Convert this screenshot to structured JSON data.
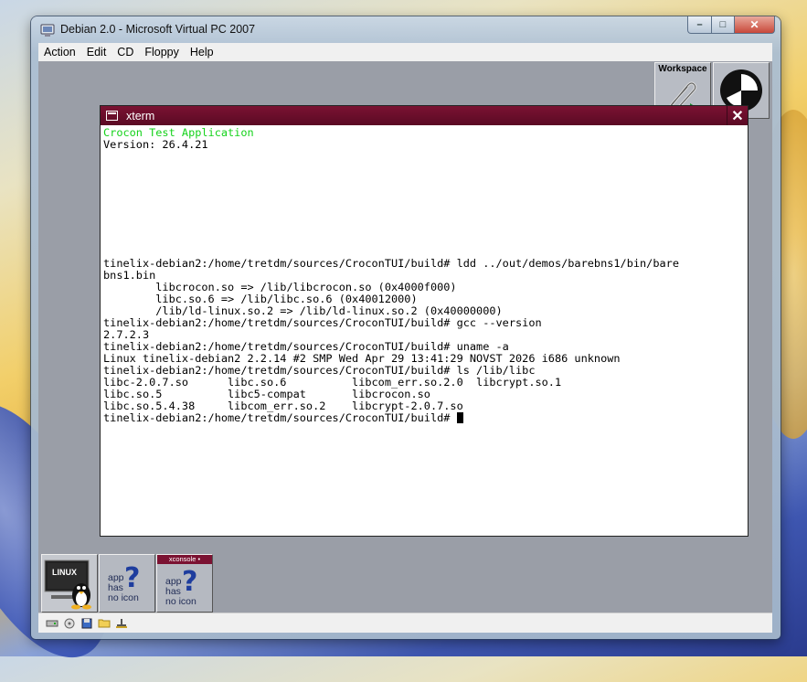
{
  "window": {
    "title": "Debian 2.0 - Microsoft Virtual PC 2007",
    "caption_buttons": {
      "minimize": "–",
      "maximize": "□",
      "close": "✕"
    }
  },
  "menubar": [
    "Action",
    "Edit",
    "CD",
    "Floppy",
    "Help"
  ],
  "dock": {
    "workspace_label": "Workspace"
  },
  "xterm": {
    "title": "xterm",
    "close_glyph": "✕",
    "header_lines": [
      "Crocon Test Application"
    ],
    "lines": [
      "Version: 26.4.21",
      "",
      "",
      "",
      "",
      "",
      "",
      "",
      "",
      "",
      "tinelix-debian2:/home/tretdm/sources/CroconTUI/build# ldd ../out/demos/barebns1/bin/bare",
      "bns1.bin",
      "        libcrocon.so => /lib/libcrocon.so (0x4000f000)",
      "        libc.so.6 => /lib/libc.so.6 (0x40012000)",
      "        /lib/ld-linux.so.2 => /lib/ld-linux.so.2 (0x40000000)",
      "tinelix-debian2:/home/tretdm/sources/CroconTUI/build# gcc --version",
      "2.7.2.3",
      "tinelix-debian2:/home/tretdm/sources/CroconTUI/build# uname -a",
      "Linux tinelix-debian2 2.2.14 #2 SMP Wed Apr 29 13:41:29 NOVST 2026 i686 unknown",
      "tinelix-debian2:/home/tretdm/sources/CroconTUI/build# ls /lib/libc",
      "libc-2.0.7.so      libc.so.6          libcom_err.so.2.0  libcrypt.so.1",
      "libc.so.5          libc5-compat       libcrocon.so",
      "libc.so.5.4.38     libcom_err.so.2    libcrypt-2.0.7.so"
    ],
    "prompt": "tinelix-debian2:/home/tretdm/sources/CroconTUI/build# "
  },
  "taskbar": {
    "linux_label": "LINUX",
    "app1_text": [
      "app",
      "has",
      "no icon"
    ],
    "app2_caption": "xconsole •",
    "app2_text": [
      "app",
      "has",
      "no icon"
    ]
  },
  "colors": {
    "xterm_title": "#7b1232",
    "green_text": "#14d21a",
    "desktop_gray": "#9a9ea7"
  }
}
